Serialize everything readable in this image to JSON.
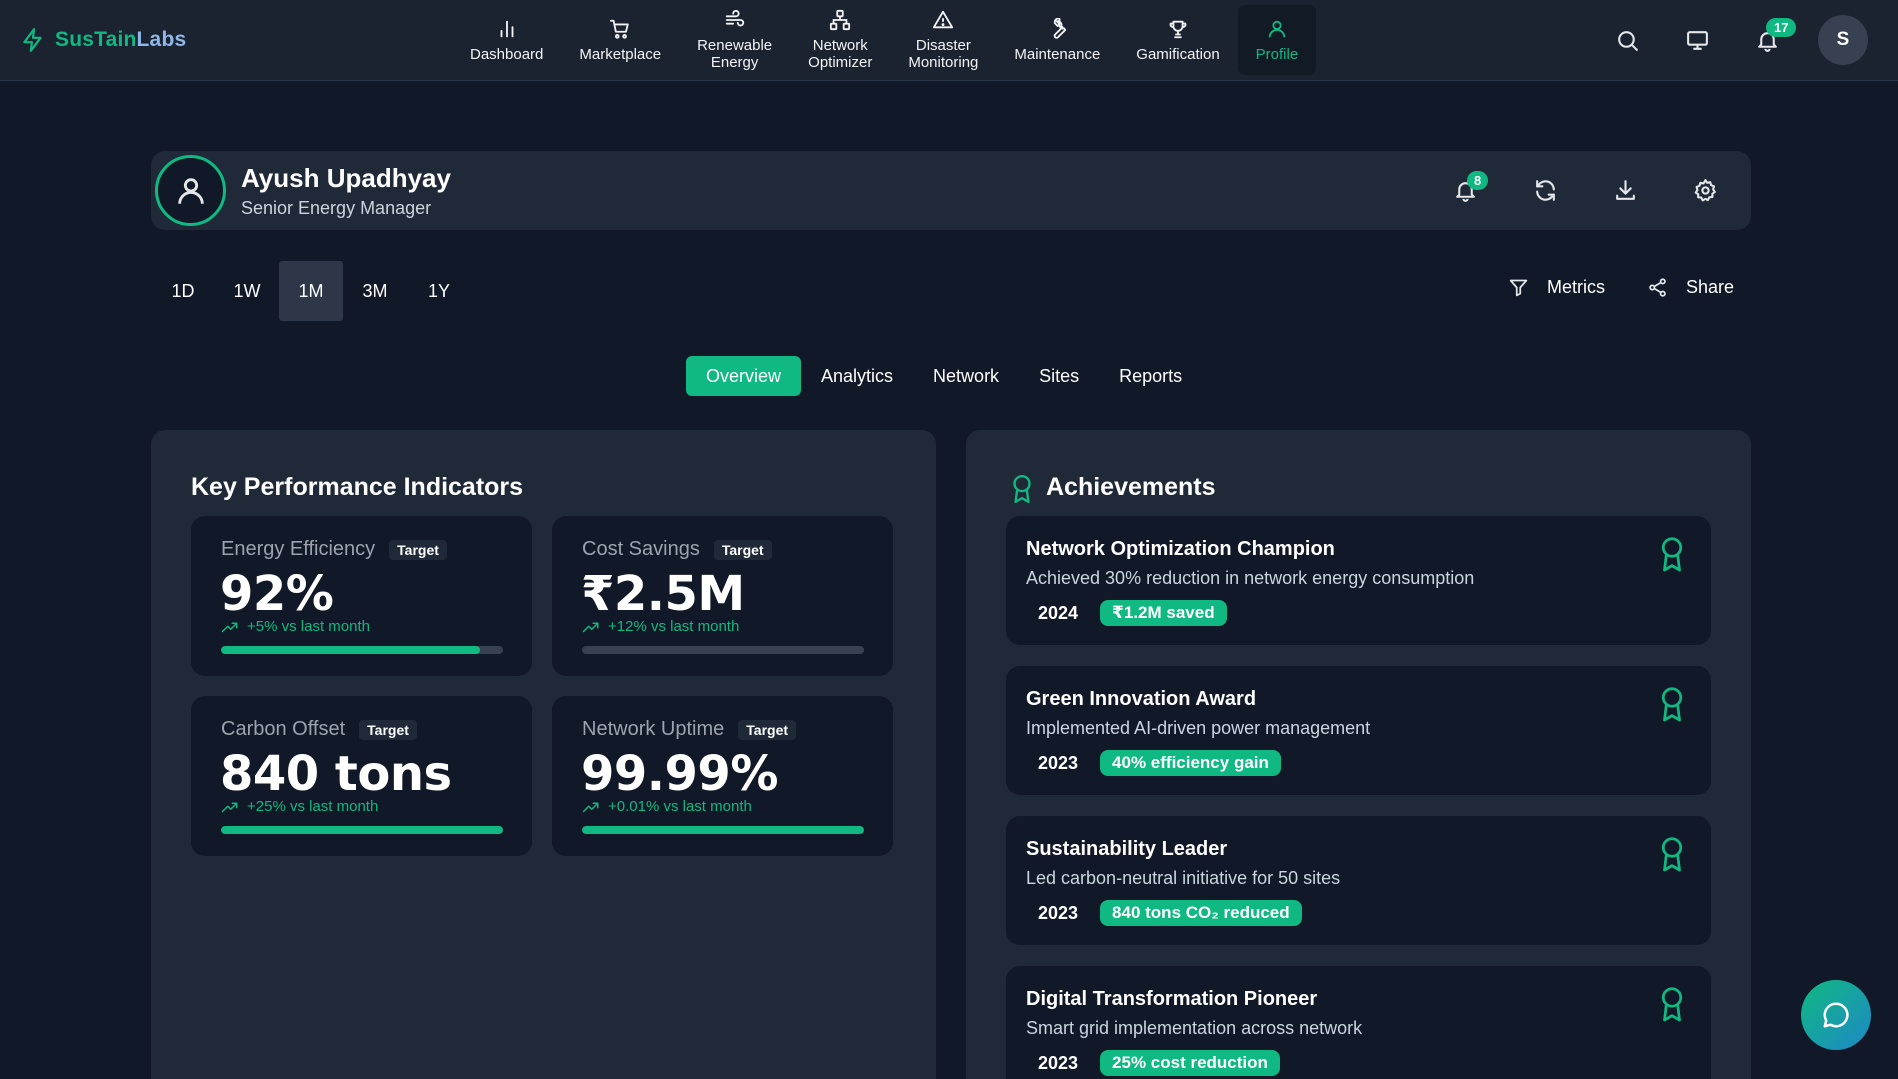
{
  "brand": {
    "name_main": "SusTain",
    "name_accent": "Labs"
  },
  "nav": [
    {
      "label": "Dashboard",
      "icon": "bar-chart-icon"
    },
    {
      "label": "Marketplace",
      "icon": "cart-icon"
    },
    {
      "label": "Renewable\nEnergy",
      "icon": "wind-icon"
    },
    {
      "label": "Network\nOptimizer",
      "icon": "network-icon"
    },
    {
      "label": "Disaster\nMonitoring",
      "icon": "alert-icon"
    },
    {
      "label": "Maintenance",
      "icon": "wrench-icon"
    },
    {
      "label": "Gamification",
      "icon": "trophy-icon"
    },
    {
      "label": "Profile",
      "icon": "user-icon",
      "active": true
    }
  ],
  "topbar": {
    "notification_count": "17",
    "avatar_initial": "S"
  },
  "profile": {
    "name": "Ayush Upadhyay",
    "role": "Senior Energy Manager",
    "notification_count": "8"
  },
  "ranges": [
    "1D",
    "1W",
    "1M",
    "3M",
    "1Y"
  ],
  "active_range": "1M",
  "tools": {
    "metrics_label": "Metrics",
    "share_label": "Share"
  },
  "tabs": [
    "Overview",
    "Analytics",
    "Network",
    "Sites",
    "Reports"
  ],
  "active_tab": "Overview",
  "kpi": {
    "title": "Key Performance Indicators",
    "target_label": "Target",
    "cards": [
      {
        "label": "Energy Efficiency",
        "value": "92%",
        "delta": "+5% vs last month",
        "progress": 92
      },
      {
        "label": "Cost Savings",
        "value": "₹2.5M",
        "delta": "+12% vs last month",
        "progress": 0
      },
      {
        "label": "Carbon Offset",
        "value": "840 tons",
        "delta": "+25% vs last month",
        "progress": 100
      },
      {
        "label": "Network Uptime",
        "value": "99.99%",
        "delta": "+0.01% vs last month",
        "progress": 99.99
      }
    ]
  },
  "achievements": {
    "title": "Achievements",
    "items": [
      {
        "title": "Network Optimization Champion",
        "desc": "Achieved 30% reduction in network energy consumption",
        "year": "2024",
        "tag": "₹1.2M saved"
      },
      {
        "title": "Green Innovation Award",
        "desc": "Implemented AI-driven power management",
        "year": "2023",
        "tag": "40% efficiency gain"
      },
      {
        "title": "Sustainability Leader",
        "desc": "Led carbon-neutral initiative for 50 sites",
        "year": "2023",
        "tag": "840 tons CO₂ reduced"
      },
      {
        "title": "Digital Transformation Pioneer",
        "desc": "Smart grid implementation across network",
        "year": "2023",
        "tag": "25% cost reduction"
      }
    ]
  },
  "colors": {
    "accent": "#10b981",
    "background": "#111827",
    "surface": "#1f2937"
  }
}
